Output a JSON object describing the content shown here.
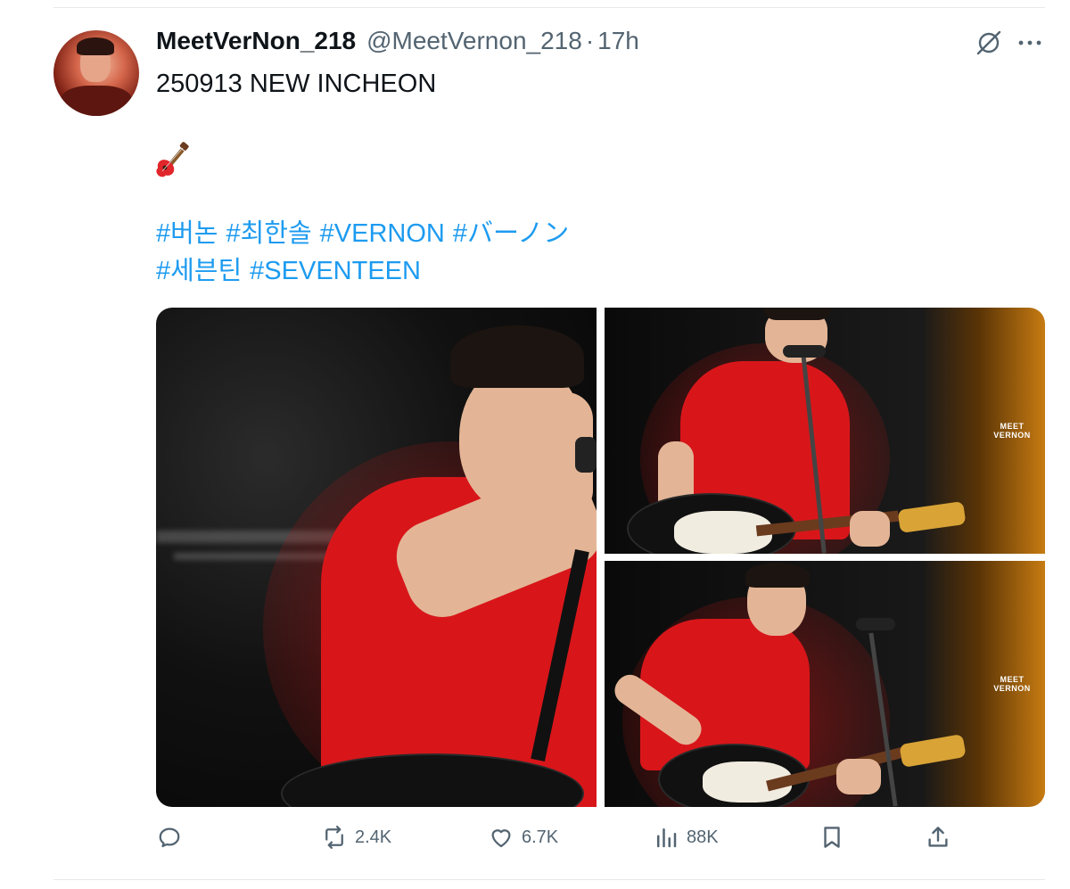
{
  "tweet": {
    "display_name": "MeetVerNon_218",
    "handle": "@MeetVernon_218",
    "separator": "·",
    "time": "17h",
    "text_line1": "250913 NEW INCHEON",
    "emoji": "guitar-emoji",
    "hashtags_line1": [
      "#버논",
      "#최한솔",
      "#VERNON",
      "#バーノン"
    ],
    "hashtags_line2": [
      "#세븐틴",
      "#SEVENTEEN"
    ]
  },
  "media": {
    "watermark_line1": "MEET",
    "watermark_line2": "VERNON"
  },
  "actions": {
    "reply": {
      "icon": "reply-icon",
      "count": ""
    },
    "repost": {
      "icon": "repost-icon",
      "count": "2.4K"
    },
    "like": {
      "icon": "heart-icon",
      "count": "6.7K"
    },
    "views": {
      "icon": "views-chart-icon",
      "count": "88K"
    },
    "bookmark": {
      "icon": "bookmark-icon"
    },
    "share": {
      "icon": "share-icon"
    }
  },
  "colors": {
    "text": "#0f1419",
    "secondary": "#536471",
    "link": "#1d9bf0",
    "divider": "#e6e9ec"
  }
}
